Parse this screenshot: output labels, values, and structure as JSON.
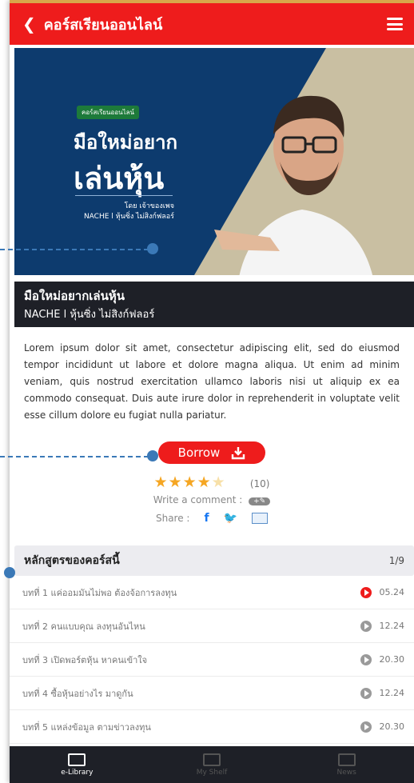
{
  "header": {
    "back_icon": "chevron-left-icon",
    "title": "คอร์สเรียนออนไลน์",
    "menu_icon": "hamburger-icon"
  },
  "banner": {
    "badge": "คอร์สเรียนออนไลน์",
    "title_line1": "มือใหม่อยาก",
    "title_line2": "เล่นหุ้น",
    "by_line1": "โดย เจ้าของเพจ",
    "by_line2": "NACHE l หุ้นซิ่ง ไม่สิงก์ฟลอร์",
    "caption_title": "มือใหม่อยากเล่นหุ้น",
    "caption_author": "NACHE l หุ้นซิ่ง ไม่สิงก์ฟลอร์"
  },
  "description": "Lorem ipsum dolor sit amet, consectetur adipiscing elit, sed do eiusmod tempor incididunt ut labore et dolore magna aliqua. Ut enim ad minim veniam, quis nostrud exercitation ullamco laboris nisi ut aliquip ex ea commodo consequat. Duis aute irure dolor in reprehenderit in voluptate velit esse cillum dolore eu fugiat nulla pariatur.",
  "actions": {
    "borrow_label": "Borrow",
    "rating_stars": 4,
    "rating_max": 5,
    "rating_count": "(10)",
    "comment_label": "Write a comment :",
    "share_label": "Share :"
  },
  "curriculum": {
    "heading": "หลักสูตรของคอร์สนี้",
    "page": "1/9",
    "lessons": [
      {
        "title": "บทที่ 1 แค่ออมมันไม่พอ ต้องจ้อการลงทุน",
        "time": "05.24",
        "active": true
      },
      {
        "title": "บทที่ 2 คนแบบคุณ ลงทุนอันไหน",
        "time": "12.24",
        "active": false
      },
      {
        "title": "บทที่ 3 เปิดพอร์ตหุ้น หาคนเข้าใจ",
        "time": "20.30",
        "active": false
      },
      {
        "title": "บทที่ 4 ซื้อหุ้นอย่างไร มาดูกัน",
        "time": "12.24",
        "active": false
      },
      {
        "title": "บทที่ 5 แหล่งข้อมูล ตามข่าวลงทุน",
        "time": "20.30",
        "active": false
      }
    ]
  },
  "bottom_nav": [
    {
      "label": "e-Library",
      "icon": "book-open-icon",
      "active": true
    },
    {
      "label": "My Shelf",
      "icon": "shelf-icon",
      "active": false
    },
    {
      "label": "News",
      "icon": "news-icon",
      "active": false
    }
  ],
  "colors": {
    "accent": "#ee1c1c",
    "navy": "#0d3b6e",
    "annotation": "#3b79b7",
    "dark_bar": "#1e2027"
  }
}
